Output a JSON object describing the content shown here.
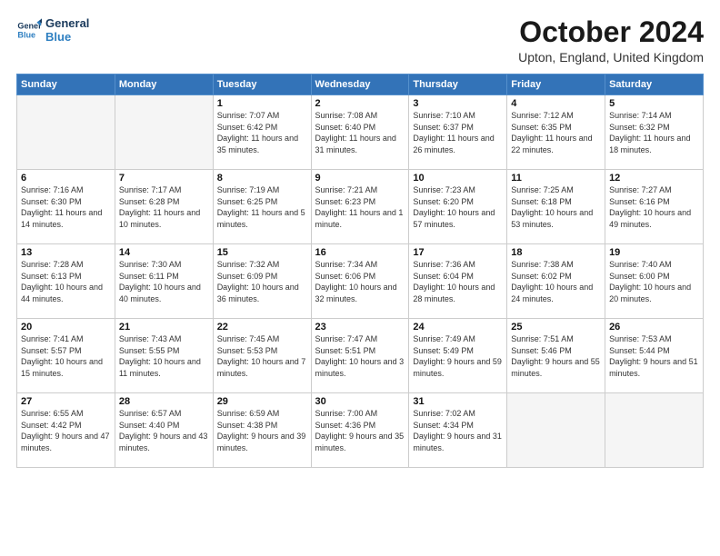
{
  "header": {
    "logo_line1": "General",
    "logo_line2": "Blue",
    "title": "October 2024",
    "location": "Upton, England, United Kingdom"
  },
  "days_of_week": [
    "Sunday",
    "Monday",
    "Tuesday",
    "Wednesday",
    "Thursday",
    "Friday",
    "Saturday"
  ],
  "weeks": [
    [
      {
        "day": "",
        "info": ""
      },
      {
        "day": "",
        "info": ""
      },
      {
        "day": "1",
        "info": "Sunrise: 7:07 AM\nSunset: 6:42 PM\nDaylight: 11 hours and 35 minutes."
      },
      {
        "day": "2",
        "info": "Sunrise: 7:08 AM\nSunset: 6:40 PM\nDaylight: 11 hours and 31 minutes."
      },
      {
        "day": "3",
        "info": "Sunrise: 7:10 AM\nSunset: 6:37 PM\nDaylight: 11 hours and 26 minutes."
      },
      {
        "day": "4",
        "info": "Sunrise: 7:12 AM\nSunset: 6:35 PM\nDaylight: 11 hours and 22 minutes."
      },
      {
        "day": "5",
        "info": "Sunrise: 7:14 AM\nSunset: 6:32 PM\nDaylight: 11 hours and 18 minutes."
      }
    ],
    [
      {
        "day": "6",
        "info": "Sunrise: 7:16 AM\nSunset: 6:30 PM\nDaylight: 11 hours and 14 minutes."
      },
      {
        "day": "7",
        "info": "Sunrise: 7:17 AM\nSunset: 6:28 PM\nDaylight: 11 hours and 10 minutes."
      },
      {
        "day": "8",
        "info": "Sunrise: 7:19 AM\nSunset: 6:25 PM\nDaylight: 11 hours and 5 minutes."
      },
      {
        "day": "9",
        "info": "Sunrise: 7:21 AM\nSunset: 6:23 PM\nDaylight: 11 hours and 1 minute."
      },
      {
        "day": "10",
        "info": "Sunrise: 7:23 AM\nSunset: 6:20 PM\nDaylight: 10 hours and 57 minutes."
      },
      {
        "day": "11",
        "info": "Sunrise: 7:25 AM\nSunset: 6:18 PM\nDaylight: 10 hours and 53 minutes."
      },
      {
        "day": "12",
        "info": "Sunrise: 7:27 AM\nSunset: 6:16 PM\nDaylight: 10 hours and 49 minutes."
      }
    ],
    [
      {
        "day": "13",
        "info": "Sunrise: 7:28 AM\nSunset: 6:13 PM\nDaylight: 10 hours and 44 minutes."
      },
      {
        "day": "14",
        "info": "Sunrise: 7:30 AM\nSunset: 6:11 PM\nDaylight: 10 hours and 40 minutes."
      },
      {
        "day": "15",
        "info": "Sunrise: 7:32 AM\nSunset: 6:09 PM\nDaylight: 10 hours and 36 minutes."
      },
      {
        "day": "16",
        "info": "Sunrise: 7:34 AM\nSunset: 6:06 PM\nDaylight: 10 hours and 32 minutes."
      },
      {
        "day": "17",
        "info": "Sunrise: 7:36 AM\nSunset: 6:04 PM\nDaylight: 10 hours and 28 minutes."
      },
      {
        "day": "18",
        "info": "Sunrise: 7:38 AM\nSunset: 6:02 PM\nDaylight: 10 hours and 24 minutes."
      },
      {
        "day": "19",
        "info": "Sunrise: 7:40 AM\nSunset: 6:00 PM\nDaylight: 10 hours and 20 minutes."
      }
    ],
    [
      {
        "day": "20",
        "info": "Sunrise: 7:41 AM\nSunset: 5:57 PM\nDaylight: 10 hours and 15 minutes."
      },
      {
        "day": "21",
        "info": "Sunrise: 7:43 AM\nSunset: 5:55 PM\nDaylight: 10 hours and 11 minutes."
      },
      {
        "day": "22",
        "info": "Sunrise: 7:45 AM\nSunset: 5:53 PM\nDaylight: 10 hours and 7 minutes."
      },
      {
        "day": "23",
        "info": "Sunrise: 7:47 AM\nSunset: 5:51 PM\nDaylight: 10 hours and 3 minutes."
      },
      {
        "day": "24",
        "info": "Sunrise: 7:49 AM\nSunset: 5:49 PM\nDaylight: 9 hours and 59 minutes."
      },
      {
        "day": "25",
        "info": "Sunrise: 7:51 AM\nSunset: 5:46 PM\nDaylight: 9 hours and 55 minutes."
      },
      {
        "day": "26",
        "info": "Sunrise: 7:53 AM\nSunset: 5:44 PM\nDaylight: 9 hours and 51 minutes."
      }
    ],
    [
      {
        "day": "27",
        "info": "Sunrise: 6:55 AM\nSunset: 4:42 PM\nDaylight: 9 hours and 47 minutes."
      },
      {
        "day": "28",
        "info": "Sunrise: 6:57 AM\nSunset: 4:40 PM\nDaylight: 9 hours and 43 minutes."
      },
      {
        "day": "29",
        "info": "Sunrise: 6:59 AM\nSunset: 4:38 PM\nDaylight: 9 hours and 39 minutes."
      },
      {
        "day": "30",
        "info": "Sunrise: 7:00 AM\nSunset: 4:36 PM\nDaylight: 9 hours and 35 minutes."
      },
      {
        "day": "31",
        "info": "Sunrise: 7:02 AM\nSunset: 4:34 PM\nDaylight: 9 hours and 31 minutes."
      },
      {
        "day": "",
        "info": ""
      },
      {
        "day": "",
        "info": ""
      }
    ]
  ]
}
